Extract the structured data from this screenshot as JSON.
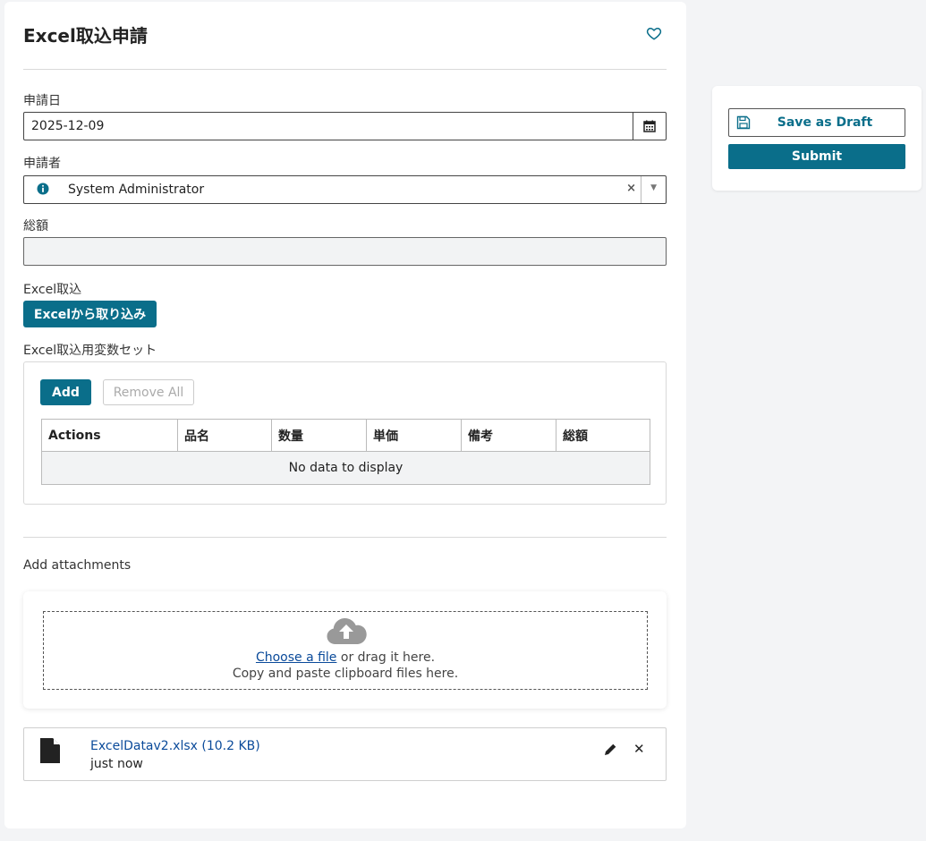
{
  "form": {
    "title": "Excel取込申請",
    "date": {
      "label": "申請日",
      "value": "2025-12-09"
    },
    "applicant": {
      "label": "申請者",
      "value": "System Administrator"
    },
    "total": {
      "label": "総額",
      "value": ""
    },
    "excel_import": {
      "label": "Excel取込",
      "button": "Excelから取り込み"
    },
    "variable_set": {
      "label": "Excel取込用変数セット",
      "add_button": "Add",
      "remove_all_button": "Remove All",
      "columns": [
        "Actions",
        "品名",
        "数量",
        "単価",
        "備考",
        "総額"
      ],
      "empty_text": "No data to display"
    },
    "attachments": {
      "label": "Add attachments",
      "choose_link": "Choose a file",
      "drag_text": " or drag it here.",
      "paste_text": "Copy and paste clipboard files here.",
      "file": {
        "name": "ExcelDatav2.xlsx (10.2 KB)",
        "time": "just now"
      }
    }
  },
  "sidebar": {
    "save_draft": "Save as Draft",
    "submit": "Submit"
  },
  "colors": {
    "primary": "#0a6e8a",
    "link": "#0a4a9a"
  }
}
